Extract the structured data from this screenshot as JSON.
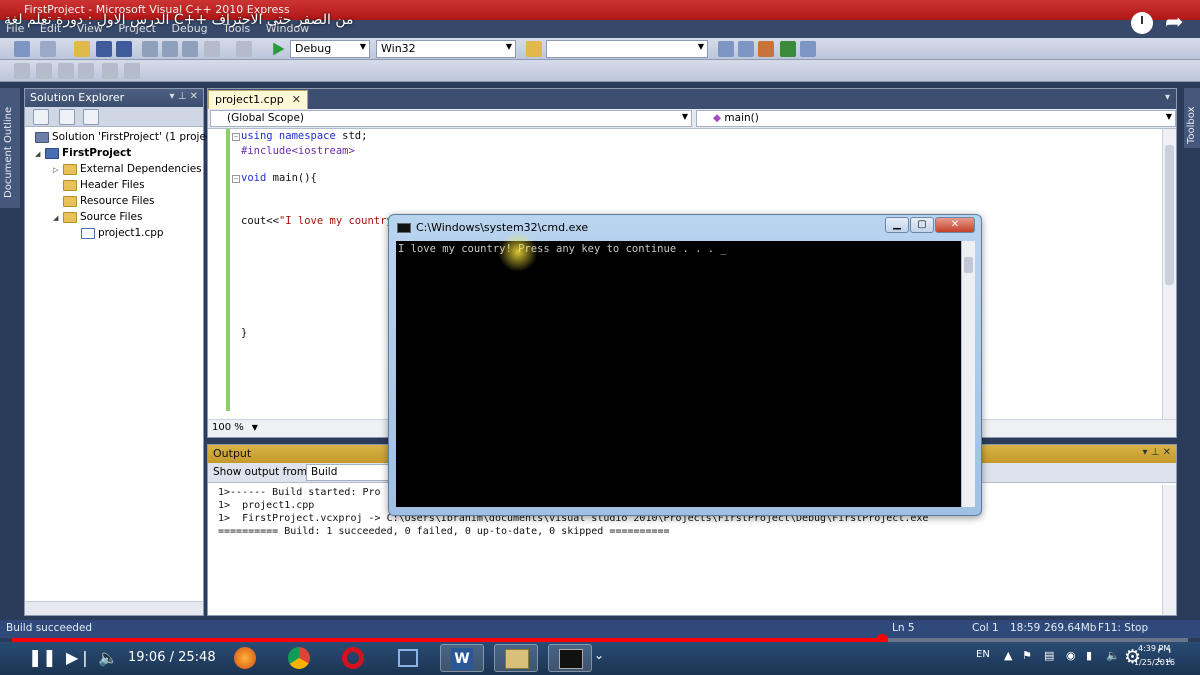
{
  "window": {
    "title": "FirstProject - Microsoft Visual C++ 2010 Express",
    "menu": [
      "File",
      "Edit",
      "View",
      "Project",
      "Debug",
      "Tools",
      "Window"
    ]
  },
  "toolbar": {
    "config": "Debug",
    "platform": "Win32",
    "find": ""
  },
  "left_tab": "Document Outline",
  "right_tab": "Toolbox",
  "solution_explorer": {
    "title": "Solution Explorer",
    "items": [
      {
        "label": "Solution 'FirstProject' (1 project",
        "icon": "solution-icon"
      },
      {
        "label": "FirstProject",
        "icon": "project-icon"
      },
      {
        "label": "External Dependencies",
        "icon": "folder-icon"
      },
      {
        "label": "Header Files",
        "icon": "folder-icon"
      },
      {
        "label": "Resource Files",
        "icon": "folder-icon"
      },
      {
        "label": "Source Files",
        "icon": "folder-icon"
      },
      {
        "label": "project1.cpp",
        "icon": "cpp-file-icon"
      }
    ]
  },
  "editor": {
    "tab": "project1.cpp",
    "scope": "(Global Scope)",
    "function": "main()",
    "zoom": "100 %",
    "lines": [
      {
        "kw": "using namespace",
        "rest": " std;"
      },
      {
        "pp": "#include<iostream>"
      },
      {
        "kw": "void",
        "rest": " main(){"
      },
      {
        "plain": "cout<<",
        "str": "\"I love my country"
      },
      {
        "plain": "}"
      }
    ]
  },
  "output": {
    "title": "Output",
    "show_from_label": "Show output from:",
    "show_from_value": "Build",
    "lines": [
      "1>------ Build started: Pro",
      "1>  project1.cpp",
      "1>  FirstProject.vcxproj -> C:\\Users\\Ibrahim\\documents\\visual studio 2010\\Projects\\FirstProject\\Debug\\FirstProject.exe",
      "========== Build: 1 succeeded, 0 failed, 0 up-to-date, 0 skipped =========="
    ]
  },
  "statusbar": {
    "message": "Build succeeded",
    "ln": "Ln 5",
    "col": "Col 1",
    "time": "18:59",
    "memory": "269.64Mb",
    "stop": "F11: Stop"
  },
  "cmd": {
    "title": "C:\\Windows\\system32\\cmd.exe",
    "output": "I love my country! Press any key to continue . . . _"
  },
  "youtube": {
    "title": "من الصفر حتى الاحتراف ++C الدرس الاول : دورة تعلم لغة",
    "current_time": "19:06",
    "duration": "25:48",
    "separator": " / ",
    "progress": 0.74,
    "lang": "EN",
    "clock_time": "4:39 PM",
    "clock_date": "1/25/2016"
  }
}
